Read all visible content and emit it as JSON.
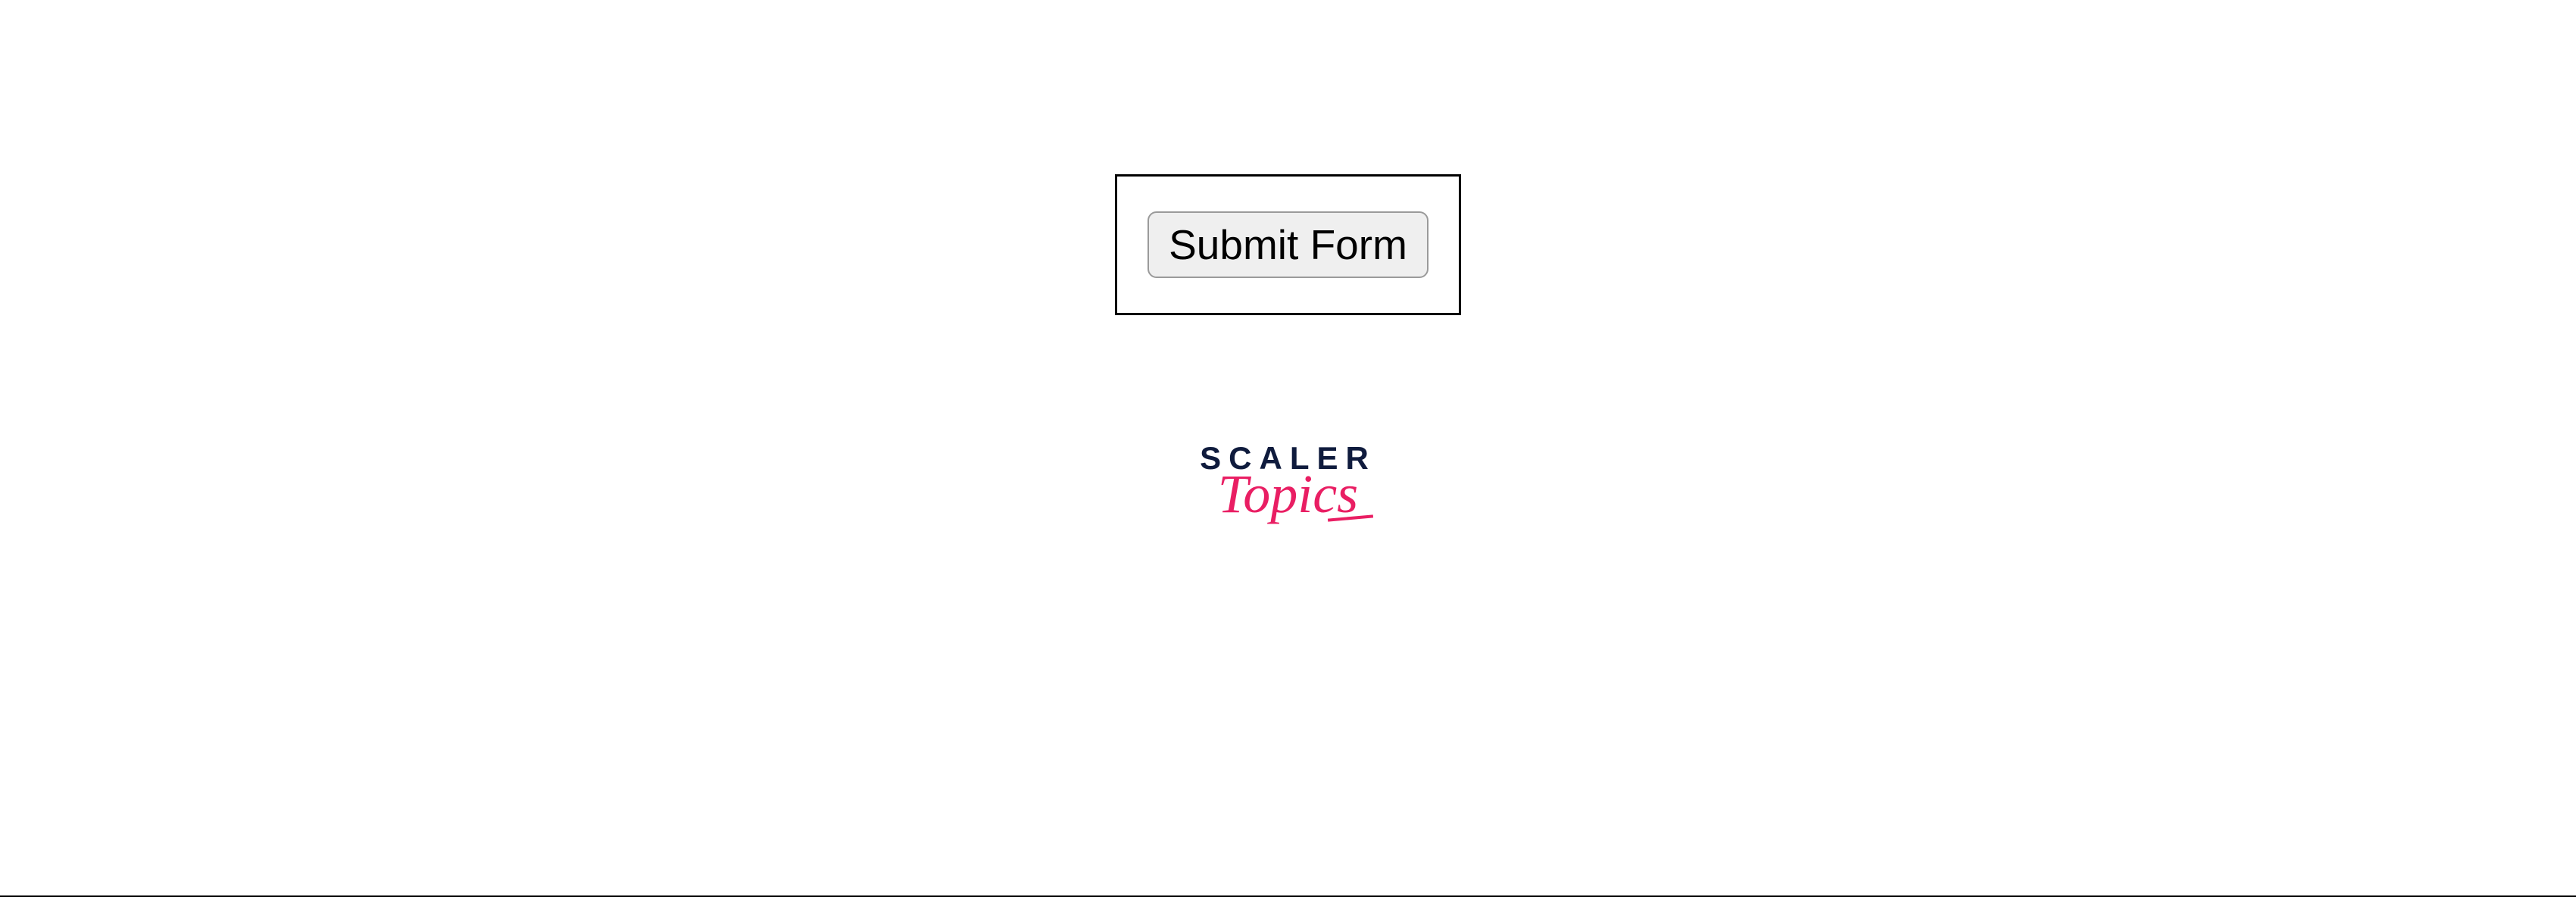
{
  "button": {
    "label": "Submit Form"
  },
  "logo": {
    "main": "SCALER",
    "sub": "Topics"
  }
}
